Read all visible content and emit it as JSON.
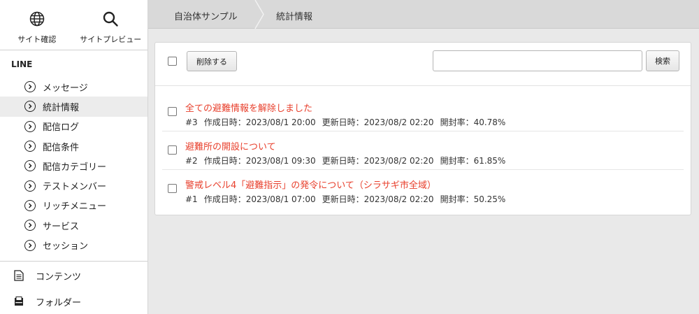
{
  "sidebar": {
    "tools": [
      {
        "label": "サイト確認",
        "icon": "globe-icon"
      },
      {
        "label": "サイトプレビュー",
        "icon": "magnifier-icon"
      }
    ],
    "section_title": "LINE",
    "items": [
      {
        "label": "メッセージ"
      },
      {
        "label": "統計情報",
        "active": true
      },
      {
        "label": "配信ログ"
      },
      {
        "label": "配信条件"
      },
      {
        "label": "配信カテゴリー"
      },
      {
        "label": "テストメンバー"
      },
      {
        "label": "リッチメニュー"
      },
      {
        "label": "サービス"
      },
      {
        "label": "セッション"
      }
    ],
    "bottom": [
      {
        "label": "コンテンツ",
        "icon": "document-icon"
      },
      {
        "label": "フォルダー",
        "icon": "folder-tray-icon"
      }
    ]
  },
  "breadcrumb": {
    "items": [
      "自治体サンプル",
      "統計情報"
    ]
  },
  "toolbar": {
    "delete_label": "削除する",
    "search_value": "",
    "search_label": "検索"
  },
  "rows": [
    {
      "title": "全ての避難情報を解除しました",
      "id": "#3",
      "created": "作成日時：2023/08/1 20:00",
      "updated": "更新日時：2023/08/2 02:20",
      "open_rate": "開封率：40.78%"
    },
    {
      "title": "避難所の開設について",
      "id": "#2",
      "created": "作成日時：2023/08/1 09:30",
      "updated": "更新日時：2023/08/2 02:20",
      "open_rate": "開封率：61.85%"
    },
    {
      "title": "警戒レベル4「避難指示」の発令について（シラサギ市全域）",
      "id": "#1",
      "created": "作成日時：2023/08/1 07:00",
      "updated": "更新日時：2023/08/2 02:20",
      "open_rate": "開封率：50.25%"
    }
  ],
  "colors": {
    "title_red": "#e8402d",
    "active_bg": "#ececec",
    "breadcrumb_bg": "#d9d9d9"
  }
}
